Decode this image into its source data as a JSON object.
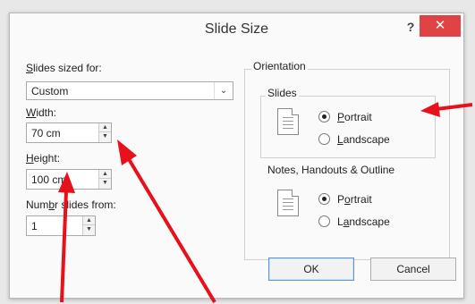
{
  "dialog": {
    "title": "Slide Size",
    "help": "?",
    "close": "✕"
  },
  "slides_sized_for": {
    "label_underlined": "S",
    "label_rest": "lides sized for:",
    "value": "Custom",
    "dropdown_icon": "chevron-down-icon"
  },
  "width": {
    "label_underlined": "W",
    "label_rest": "idth:",
    "value": "70 cm"
  },
  "height": {
    "label_underlined": "H",
    "label_rest": "eight:",
    "value": "100 cm"
  },
  "number_from": {
    "label_pre": "Num",
    "label_underlined": "b",
    "label_post": "r slides from:",
    "value": "1"
  },
  "orientation": {
    "legend": "Orientation",
    "slides": {
      "legend": "Slides",
      "portrait": {
        "underlined": "P",
        "rest": "ortrait",
        "selected": true
      },
      "landscape": {
        "underlined": "L",
        "rest": "andscape",
        "selected": false
      }
    },
    "notes": {
      "legend": "Notes, Handouts & Outline",
      "portrait": {
        "pre": "P",
        "underlined": "o",
        "rest": "rtrait",
        "selected": true
      },
      "landscape": {
        "pre": "L",
        "underlined": "a",
        "rest": "ndscape",
        "selected": false
      }
    }
  },
  "buttons": {
    "ok": "OK",
    "cancel": "Cancel"
  },
  "annotation_color": "#e8101a"
}
